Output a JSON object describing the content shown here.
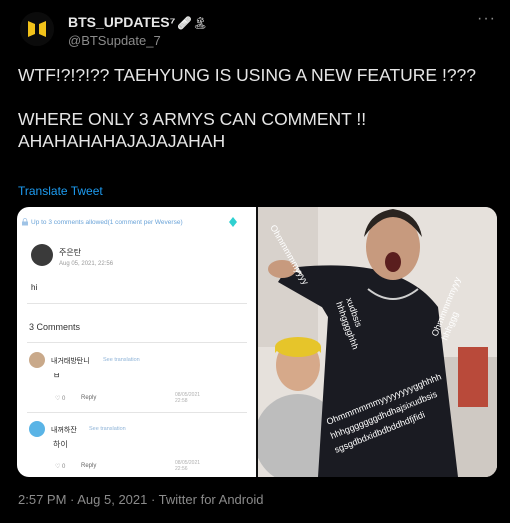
{
  "account": {
    "display_name": "BTS_UPDATES⁷",
    "name_emoji": "🩹🏝",
    "handle": "@BTSupdate_7",
    "more_icon": "more-horizontal-icon"
  },
  "tweet": {
    "text": "WTF!?!?!?? TAEHYUNG IS USING A NEW FEATURE !???\n\nWHERE ONLY 3 ARMYS CAN COMMENT !!\nAHAHAHAHAJAJAJAHAH",
    "translate_label": "Translate Tweet",
    "footer": "2:57 PM · Aug 5, 2021 · Twitter for Android"
  },
  "screenshot": {
    "notice": "Up to 3 comments allowed(1 comment per Weverse)",
    "post_author": "주은탄",
    "post_date": "Aug 05, 2021, 22:56",
    "post_text": "hi",
    "comments_count_label": "3 Comments",
    "comments": [
      {
        "name": "내거태방탄니",
        "translate": "See translation",
        "text": "ㅂ",
        "likes": "0",
        "reply": "Reply",
        "date": "08/05/2021 22:58"
      },
      {
        "name": "내꺼하잔",
        "translate": "See translation",
        "text": "하이",
        "likes": "0",
        "reply": "Reply",
        "date": "08/05/2021 22:56"
      }
    ]
  },
  "colors": {
    "background": "#000000",
    "link": "#1d9bf0",
    "muted": "#8b8b8b"
  }
}
